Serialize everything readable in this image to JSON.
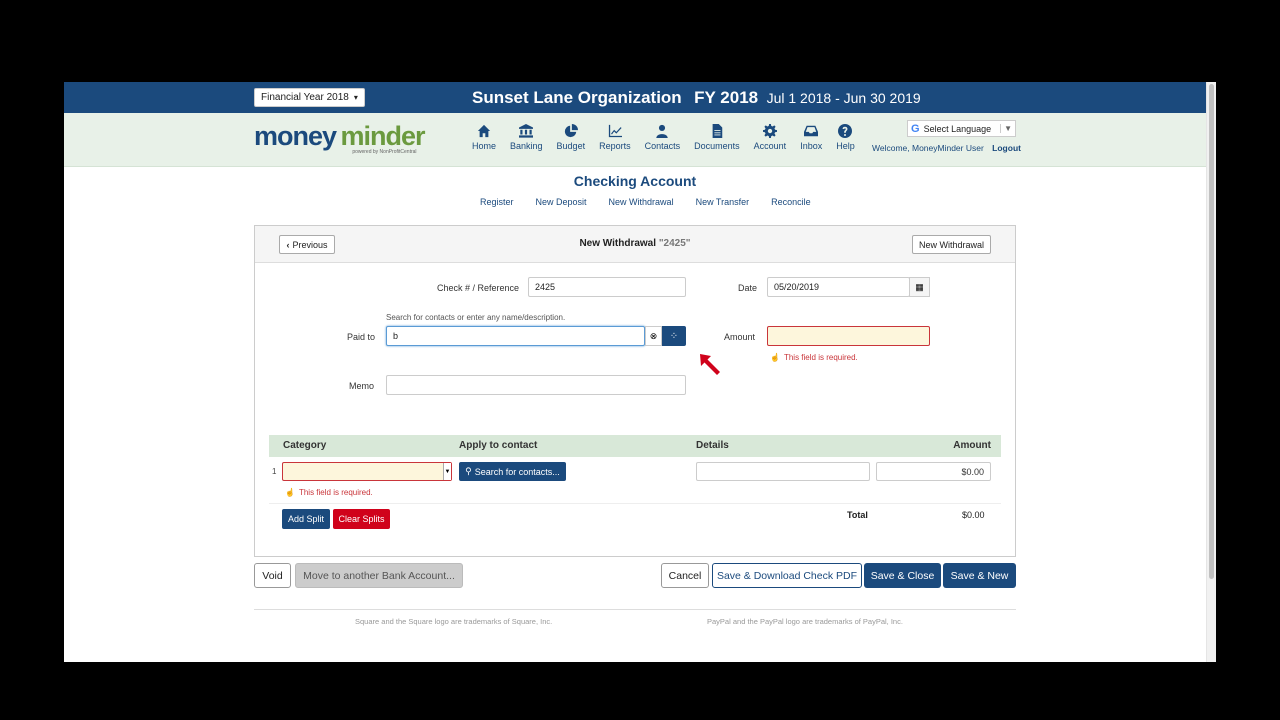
{
  "topbar": {
    "fiscal_year_select": "Financial Year 2018",
    "org_name": "Sunset Lane Organization",
    "fy_label": "FY 2018",
    "date_range": "Jul 1 2018 - Jun 30 2019"
  },
  "header": {
    "logo_part1": "money",
    "logo_part2": "minder",
    "logo_tagline": "powered by NonProfitCentral",
    "nav": [
      {
        "label": "Home",
        "icon": "home-icon"
      },
      {
        "label": "Banking",
        "icon": "bank-icon"
      },
      {
        "label": "Budget",
        "icon": "pie-chart-icon"
      },
      {
        "label": "Reports",
        "icon": "line-chart-icon"
      },
      {
        "label": "Contacts",
        "icon": "user-icon"
      },
      {
        "label": "Documents",
        "icon": "document-icon"
      },
      {
        "label": "Account",
        "icon": "gear-icon"
      },
      {
        "label": "Inbox",
        "icon": "inbox-icon"
      },
      {
        "label": "Help",
        "icon": "help-icon"
      }
    ],
    "language_select": "Select Language",
    "welcome": "Welcome, MoneyMinder User",
    "logout": "Logout"
  },
  "page": {
    "title": "Checking Account",
    "subnav": [
      "Register",
      "New Deposit",
      "New Withdrawal",
      "New Transfer",
      "Reconcile"
    ]
  },
  "form": {
    "prev_button": "Previous",
    "title": "New Withdrawal",
    "title_ref": "\"2425\"",
    "new_withdrawal_button": "New Withdrawal",
    "check_label": "Check # / Reference",
    "check_value": "2425",
    "date_label": "Date",
    "date_value": "05/20/2019",
    "paid_hint": "Search for contacts or enter any name/description.",
    "paid_label": "Paid to",
    "paid_value": "b",
    "amount_label": "Amount",
    "amount_error": "This field is required.",
    "memo_label": "Memo",
    "memo_value": ""
  },
  "splits": {
    "headers": {
      "category": "Category",
      "apply": "Apply to contact",
      "details": "Details",
      "amount": "Amount"
    },
    "rows": [
      {
        "num": "1",
        "category": "",
        "contact_button": "Search for contacts...",
        "details": "",
        "amount": "$0.00",
        "error": "This field is required."
      }
    ],
    "add_split": "Add Split",
    "clear_splits": "Clear Splits",
    "total_label": "Total",
    "total_value": "$0.00"
  },
  "actions": {
    "void": "Void",
    "move": "Move to another Bank Account...",
    "cancel": "Cancel",
    "save_pdf": "Save & Download Check PDF",
    "save_close": "Save & Close",
    "save_new": "Save & New"
  },
  "footer": {
    "square_note": "Square and the Square logo are trademarks of Square, Inc.",
    "paypal_note": "PayPal and the PayPal logo are trademarks of PayPal, Inc."
  },
  "colors": {
    "brand_blue": "#1b4a7d",
    "brand_green": "#6b9a3f",
    "error_red": "#c9353a",
    "clear_red": "#d0021b"
  }
}
